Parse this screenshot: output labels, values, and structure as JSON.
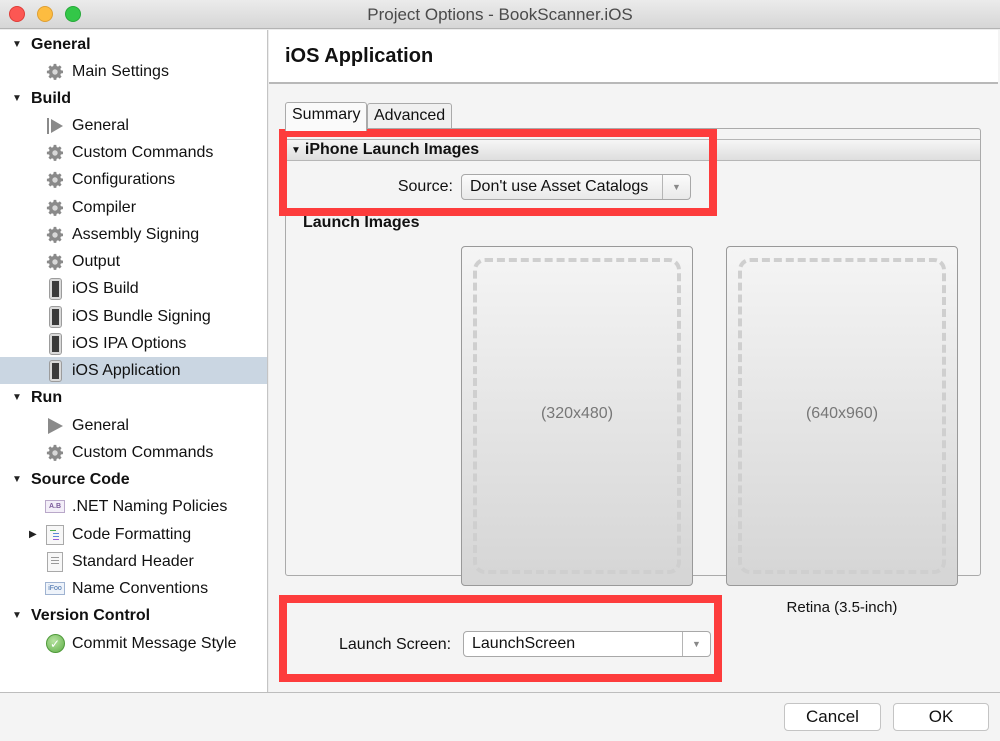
{
  "window": {
    "title": "Project Options - BookScanner.iOS"
  },
  "sidebar": {
    "categories": [
      {
        "label": "General",
        "items": [
          {
            "label": "Main Settings",
            "icon": "gear-icon"
          }
        ]
      },
      {
        "label": "Build",
        "items": [
          {
            "label": "General",
            "icon": "build-play-icon"
          },
          {
            "label": "Custom Commands",
            "icon": "gear-icon"
          },
          {
            "label": "Configurations",
            "icon": "gear-icon"
          },
          {
            "label": "Compiler",
            "icon": "gear-icon"
          },
          {
            "label": "Assembly Signing",
            "icon": "gear-icon"
          },
          {
            "label": "Output",
            "icon": "gear-icon"
          },
          {
            "label": "iOS Build",
            "icon": "iphone-icon"
          },
          {
            "label": "iOS Bundle Signing",
            "icon": "iphone-icon"
          },
          {
            "label": "iOS IPA Options",
            "icon": "iphone-icon"
          },
          {
            "label": "iOS Application",
            "icon": "iphone-icon",
            "selected": true
          }
        ]
      },
      {
        "label": "Run",
        "items": [
          {
            "label": "General",
            "icon": "play-icon"
          },
          {
            "label": "Custom Commands",
            "icon": "gear-icon"
          }
        ]
      },
      {
        "label": "Source Code",
        "items": [
          {
            "label": ".NET Naming Policies",
            "icon": "naming-policy-icon",
            "icon_text": "A.B"
          },
          {
            "label": "Code Formatting",
            "icon": "code-format-icon",
            "expandable": true
          },
          {
            "label": "Standard Header",
            "icon": "document-icon"
          },
          {
            "label": "Name Conventions",
            "icon": "name-convention-icon",
            "icon_text": "iFoo"
          }
        ]
      },
      {
        "label": "Version Control",
        "items": [
          {
            "label": "Commit Message Style",
            "icon": "checkmark-icon"
          }
        ]
      }
    ]
  },
  "main": {
    "title": "iOS Application",
    "tabs": [
      {
        "label": "Summary",
        "active": true
      },
      {
        "label": "Advanced",
        "active": false
      }
    ],
    "section": {
      "title": "iPhone Launch Images",
      "source_label": "Source:",
      "source_value": "Don't use Asset Catalogs",
      "launch_images_label": "Launch Images",
      "images": [
        {
          "dimensions": "(320x480)",
          "caption": ""
        },
        {
          "dimensions": "(640x960)",
          "caption": "Retina (3.5-inch)"
        }
      ],
      "launch_screen_label": "Launch Screen:",
      "launch_screen_value": "LaunchScreen"
    }
  },
  "footer": {
    "cancel_label": "Cancel",
    "ok_label": "OK"
  },
  "colors": {
    "highlight": "#fd3c3c",
    "selection": "#cad6e2"
  }
}
